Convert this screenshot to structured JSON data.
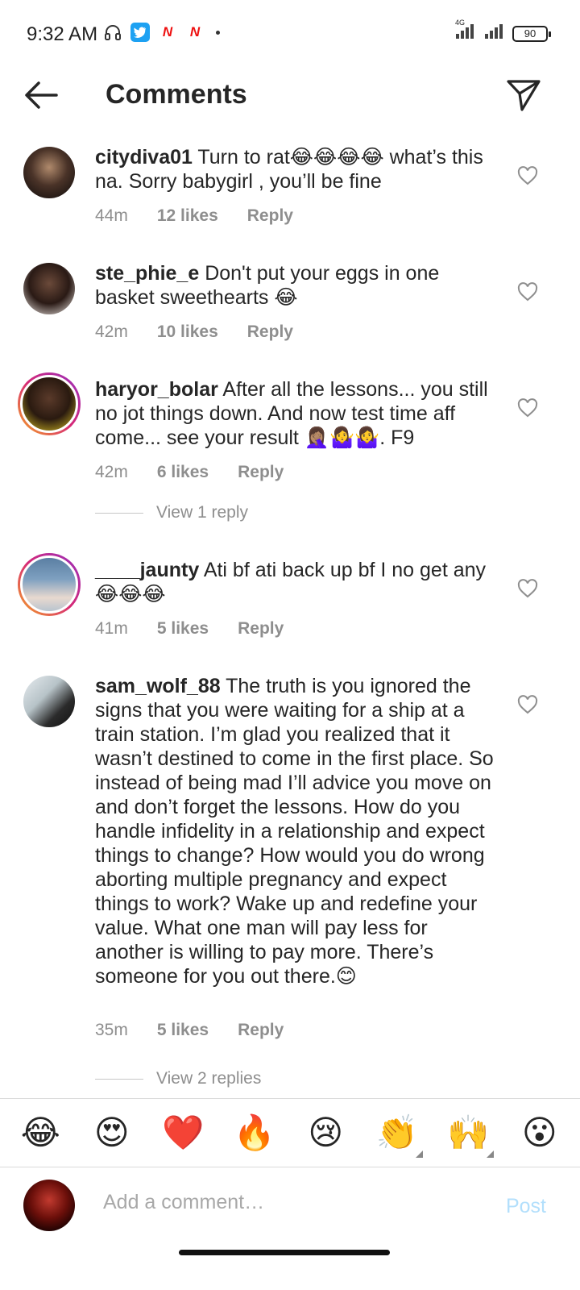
{
  "status_bar": {
    "time": "9:32 AM",
    "network_label": "4G",
    "battery": "90",
    "icons": [
      "headphones-icon",
      "twitter-icon",
      "news-icon",
      "news-icon",
      "dot-icon",
      "signal-icon",
      "signal-icon",
      "battery-icon"
    ]
  },
  "header": {
    "title": "Comments",
    "back_icon": "arrow-left-icon",
    "share_icon": "send-icon"
  },
  "comments": [
    {
      "username": "citydiva01",
      "text": " Turn to rat😂😂😂😂 what’s this na.  Sorry babygirl , you’ll be fine",
      "time": "44m",
      "likes": "12 likes",
      "reply": "Reply",
      "story_ring": false
    },
    {
      "username": "ste_phie_e",
      "text": " Don't put your eggs in one basket sweethearts 😂",
      "time": "42m",
      "likes": "10 likes",
      "reply": "Reply",
      "story_ring": false
    },
    {
      "username": "haryor_bolar",
      "text": " After all the lessons... you still no jot things down. And now test time aff come... see your result 🤦🏽‍♀️🤷‍♀️🤷‍♀️. F9",
      "time": "42m",
      "likes": "6 likes",
      "reply": "Reply",
      "story_ring": true,
      "view_replies": "View 1 reply"
    },
    {
      "username": "____jaunty",
      "text": " Ati bf ati back up bf I no get any 😂😂😂",
      "time": "41m",
      "likes": "5 likes",
      "reply": "Reply",
      "story_ring": true
    },
    {
      "username": "sam_wolf_88",
      "text": " The truth is you ignored the signs that you were waiting for a ship at a train station. I’m glad you realized that it wasn’t destined to come in the first place. So instead of being mad I’ll advice you move on and don’t forget the lessons. How do you handle infidelity in a relationship and expect things to change? How would you do wrong aborting multiple pregnancy and expect things to work? Wake up and redefine your value. What one man will pay less for another is willing to pay more. There’s someone for you out there.😊",
      "time": "35m",
      "likes": "5 likes",
      "reply": "Reply",
      "story_ring": false,
      "view_replies": "View 2 replies"
    }
  ],
  "emoji_bar": [
    "😂",
    "😍",
    "❤️",
    "🔥",
    "😢",
    "👏",
    "🙌",
    "😮"
  ],
  "composer": {
    "placeholder": "Add a comment…",
    "post_label": "Post",
    "post_color": "#b2dffc"
  }
}
